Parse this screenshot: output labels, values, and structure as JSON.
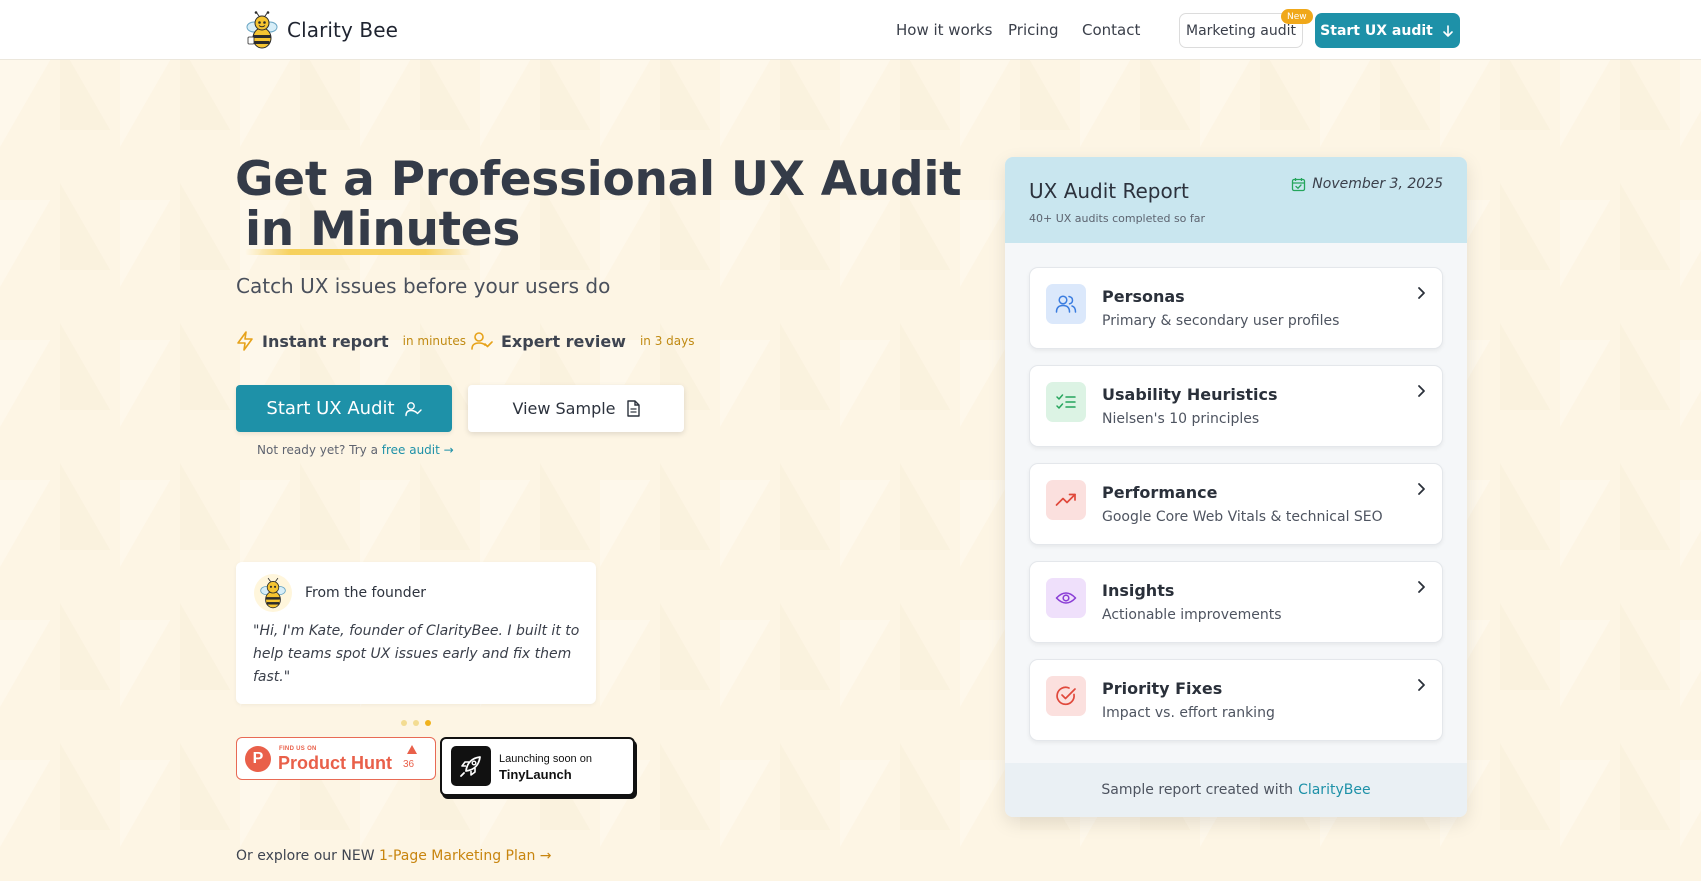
{
  "brand": {
    "name": "Clarity Bee"
  },
  "nav": {
    "links": [
      "How it works",
      "Pricing",
      "Contact"
    ],
    "marketing_label": "Marketing audit",
    "new_badge": "New",
    "start_label": "Start UX audit"
  },
  "hero": {
    "title_line1": "Get a Professional UX Audit",
    "title_line2": "in Minutes",
    "subtitle": "Catch UX issues before your users do",
    "features": [
      {
        "label": "Instant report",
        "sub": "in minutes",
        "icon": "lightning-icon"
      },
      {
        "label": "Expert review",
        "sub": "in 3 days",
        "icon": "user-check-icon"
      }
    ],
    "primary_label": "Start UX Audit",
    "secondary_label": "View Sample",
    "free_prefix": "Not ready yet? Try a",
    "free_link": "free audit →"
  },
  "founder": {
    "heading": "From the founder",
    "quote": "\"Hi, I'm Kate, founder of ClarityBee. I built it to help teams spot UX issues early and fix them fast.\""
  },
  "badges": {
    "ph_small": "FIND US ON",
    "ph_big": "Product Hunt",
    "ph_count": "36",
    "tl_small": "Launching soon on",
    "tl_big": "TinyLaunch"
  },
  "explore": {
    "prefix": "Or explore our NEW",
    "link": "1-Page Marketing Plan →"
  },
  "report": {
    "title": "UX Audit Report",
    "subtitle": "40+ UX audits completed so far",
    "date": "November 3, 2025",
    "items": [
      {
        "title": "Personas",
        "desc": "Primary & secondary user profiles",
        "icon": "users-icon",
        "color": "#3b7de0",
        "bg": "#dbe8fb"
      },
      {
        "title": "Usability Heuristics",
        "desc": "Nielsen's 10 principles",
        "icon": "checklist-icon",
        "color": "#25a55c",
        "bg": "#dcf3e4"
      },
      {
        "title": "Performance",
        "desc": "Google Core Web Vitals & technical SEO",
        "icon": "trending-up-icon",
        "color": "#e0483b",
        "bg": "#fbe0de"
      },
      {
        "title": "Insights",
        "desc": "Actionable improvements",
        "icon": "eye-icon",
        "color": "#8b3fd6",
        "bg": "#efe0fb"
      },
      {
        "title": "Priority Fixes",
        "desc": "Impact vs. effort ranking",
        "icon": "target-check-icon",
        "color": "#e0483b",
        "bg": "#fbe0de"
      }
    ],
    "footer_prefix": "Sample report created with",
    "footer_link": "ClarityBee"
  },
  "colors": {
    "accent": "#1e91a8",
    "gold": "#c08a12",
    "background": "#fdf5e4"
  }
}
